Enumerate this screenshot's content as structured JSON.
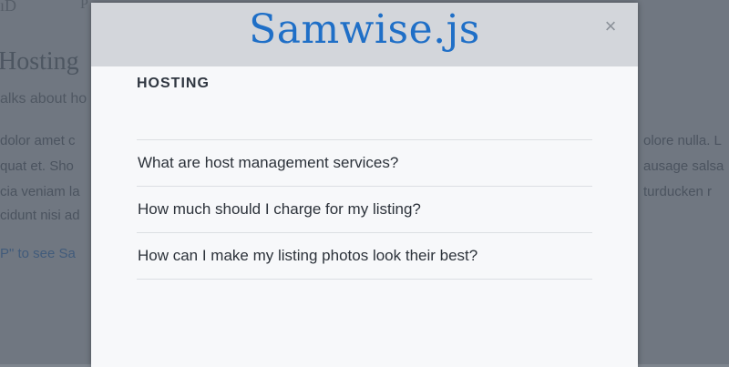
{
  "background_page": {
    "nav_fragment_1": "ıD",
    "nav_fragment_2": "P",
    "heading": "Hosting",
    "subtitle": "alks about ho",
    "body_left": [
      "dolor amet c",
      "quat et. Sho",
      "cia veniam la",
      "cidunt nisi ad"
    ],
    "body_right": [
      "olore nulla. L",
      "ausage salsa",
      "turducken r",
      ""
    ],
    "link_text": "P\" to see Sa"
  },
  "modal": {
    "title": "Samwise.js",
    "close_label": "×",
    "section_title": "HOSTING",
    "faqs": [
      "What are host management services?",
      "How much should I charge for my listing?",
      "How can I make my listing photos look their best?"
    ]
  },
  "colors": {
    "title_blue": "#1f6fc7",
    "header_bg": "#d3d6db",
    "modal_bg": "#f7f8fa",
    "page_dim": "#7e858e"
  }
}
